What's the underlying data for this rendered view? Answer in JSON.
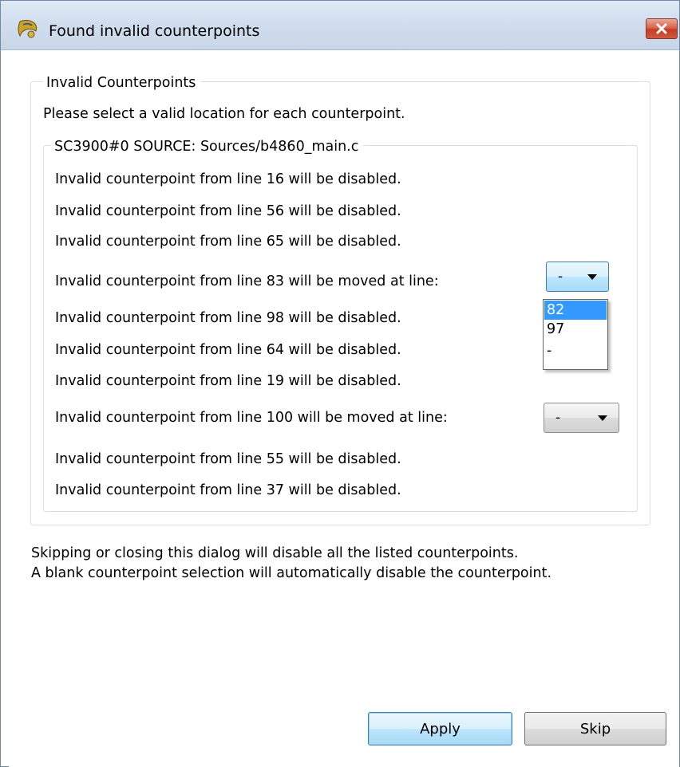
{
  "window": {
    "title": "Found invalid counterpoints"
  },
  "group": {
    "legend": "Invalid Counterpoints",
    "instruction": "Please select a valid location for each counterpoint."
  },
  "source": {
    "legend": "SC3900#0 SOURCE: Sources/b4860_main.c",
    "rows": [
      {
        "text": "Invalid counterpoint from line 16 will be disabled."
      },
      {
        "text": "Invalid counterpoint from line 56 will be disabled."
      },
      {
        "text": "Invalid counterpoint from line 65 will be disabled."
      },
      {
        "text": "Invalid counterpoint from line 83 will be moved at line:",
        "combo_value": "-"
      },
      {
        "text": "Invalid counterpoint from line 98 will be disabled."
      },
      {
        "text": "Invalid counterpoint from line 64 will be disabled."
      },
      {
        "text": "Invalid counterpoint from line 19 will be disabled."
      },
      {
        "text": "Invalid counterpoint from line 100 will be moved at line:",
        "combo_value": "-"
      },
      {
        "text": "Invalid counterpoint from line 55 will be disabled."
      },
      {
        "text": "Invalid counterpoint from line 37 will be disabled."
      }
    ]
  },
  "dropdown": {
    "options": [
      "82",
      "97",
      "-"
    ],
    "highlighted": "82"
  },
  "notes": [
    "Skipping or closing this dialog will disable all the listed counterpoints.",
    "A blank counterpoint selection will automatically disable the counterpoint."
  ],
  "buttons": {
    "apply": "Apply",
    "skip": "Skip"
  },
  "colors": {
    "selection": "#3399ff",
    "close_button": "#c63c22",
    "focus_border": "#3c7fb1"
  },
  "icons": {
    "app": "eclipse-app-icon",
    "close": "close-icon",
    "combo_arrow": "chevron-down-icon"
  }
}
